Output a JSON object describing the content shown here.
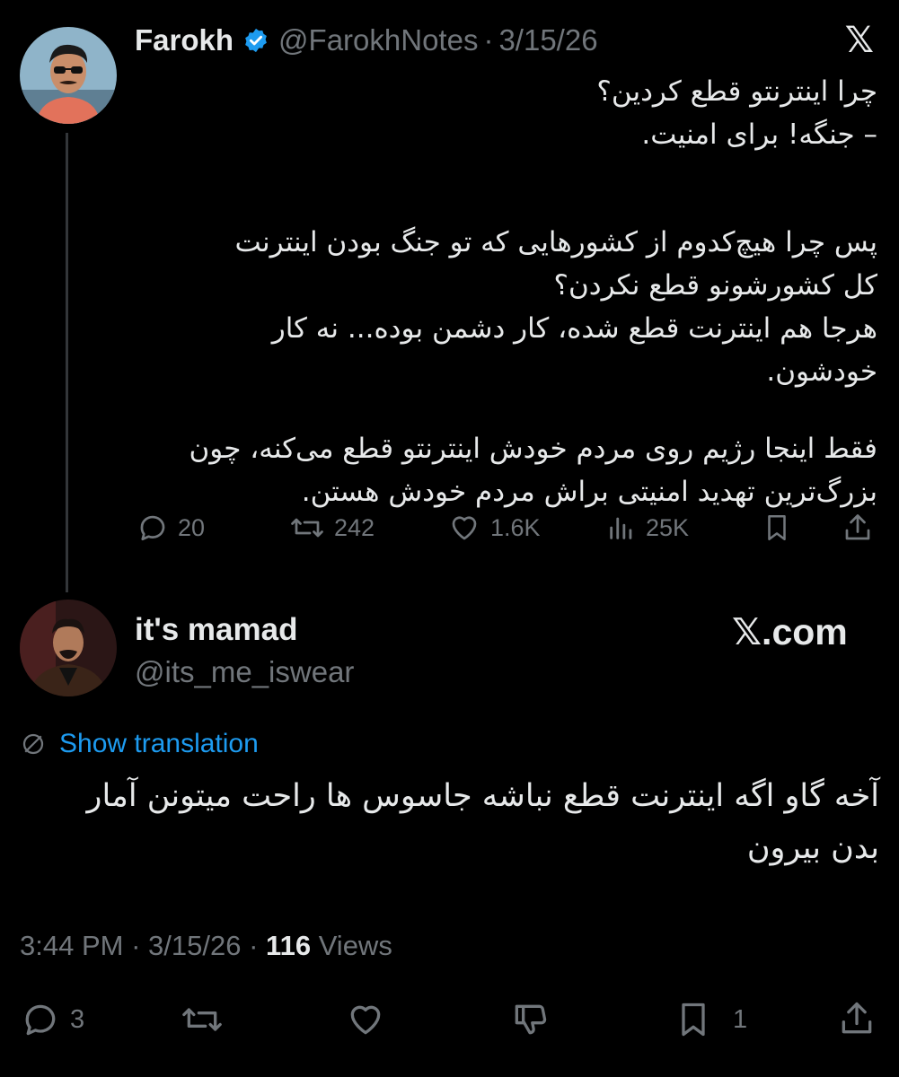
{
  "parent_tweet": {
    "display_name": "Farokh",
    "handle": "@FarokhNotes",
    "separator": "·",
    "date": "3/15/26",
    "body_lines": [
      "چرا اینترنتو قطع کردین؟",
      "– جنگه! برای امنیت.",
      "",
      "پس چرا هیچ‌کدوم از کشورهایی که تو جنگ بودن اینترنت",
      "کل کشورشونو قطع نکردن؟",
      "هرجا هم اینترنت قطع شده، کار دشمن بوده... نه کار",
      "خودشون.",
      "",
      "فقط اینجا رژیم روی مردم خودش اینترنتو قطع می‌کنه، چون",
      "بزرگ‌ترین تهدید امنیتی براش مردم خودش هستن."
    ],
    "replies": "20",
    "reposts": "242",
    "likes": "1.6K",
    "views": "25K"
  },
  "reply_tweet": {
    "display_name": "it's mamad",
    "handle": "@its_me_iswear",
    "show_translation": "Show translation",
    "body_lines": [
      "آخه گاو اگه اینترنت قطع نباشه جاسوس ها راحت میتونن آمار",
      "بدن بیرون"
    ],
    "time": "3:44 PM",
    "separator1": "·",
    "date": "3/15/26",
    "separator2": "·",
    "views_count": "116",
    "views_label": "Views",
    "replies": "3",
    "bookmarks": "1"
  },
  "branding": {
    "x_glyph": "𝕏",
    "watermark_x": "𝕏",
    "watermark_domain": ".com"
  },
  "colors": {
    "background": "#000000",
    "text": "#e7e9ea",
    "muted": "#71767b",
    "link": "#1d9bf0",
    "verified": "#1d9bf0"
  },
  "icons": [
    "reply-icon",
    "repost-icon",
    "like-icon",
    "views-icon",
    "bookmark-icon",
    "share-icon",
    "dislike-icon",
    "translate-icon",
    "verified-badge-icon"
  ]
}
